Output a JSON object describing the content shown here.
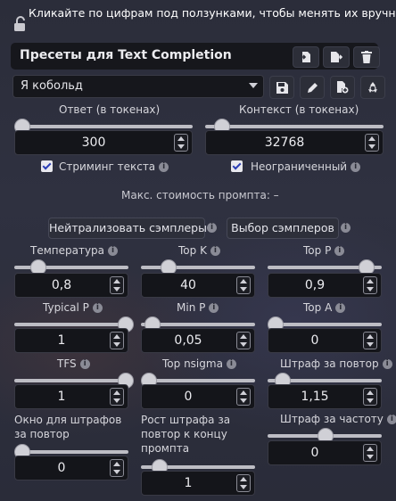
{
  "hint": "Кликайте по цифрам под ползунками, чтобы менять их вручную.",
  "presets": {
    "title": "Пресеты для Text Completion",
    "selected": "Я кобольд"
  },
  "response": {
    "label": "Ответ (в токенах)",
    "value": "300",
    "level": 0.0
  },
  "context": {
    "label": "Контекст (в токенах)",
    "value": "32768",
    "level": 0.1
  },
  "checkboxes": {
    "streaming": {
      "label": "Стриминг текста",
      "checked": true
    },
    "unlimited": {
      "label": "Неограниченный",
      "checked": true
    }
  },
  "max_cost": "Макс. стоимость промпта: –",
  "buttons": {
    "neutralize": "Нейтрализовать сэмплеры",
    "select": "Выбор сэмплеров"
  },
  "params": {
    "temperature": {
      "label": "Температура",
      "value": "0,8"
    },
    "top_k": {
      "label": "Top K",
      "value": "40"
    },
    "top_p": {
      "label": "Top P",
      "value": "0,9"
    },
    "typical_p": {
      "label": "Typical P",
      "value": "1"
    },
    "min_p": {
      "label": "Min P",
      "value": "0,05"
    },
    "top_a": {
      "label": "Top A",
      "value": "0"
    },
    "tfs": {
      "label": "TFS",
      "value": "1"
    },
    "top_nsigma": {
      "label": "Top nsigma",
      "value": "0"
    },
    "rep_pen": {
      "label": "Штраф за повтор",
      "value": "1,15"
    },
    "rep_pen_range": {
      "label_1": "Окно для штрафов",
      "label_2": "за повтор",
      "value": "0"
    },
    "rep_pen_slope": {
      "label_1": "Рост штрафа за",
      "label_2": "повтор к концу",
      "label_3": "промпта",
      "value": "1"
    },
    "freq_pen": {
      "label": "Штраф за частоту",
      "value": "0"
    }
  },
  "icons": [
    "lock-open-icon",
    "file-import-icon",
    "file-export-icon",
    "trash-icon",
    "save-icon",
    "pencil-icon",
    "file-add-icon",
    "recycle-icon",
    "info-icon"
  ]
}
